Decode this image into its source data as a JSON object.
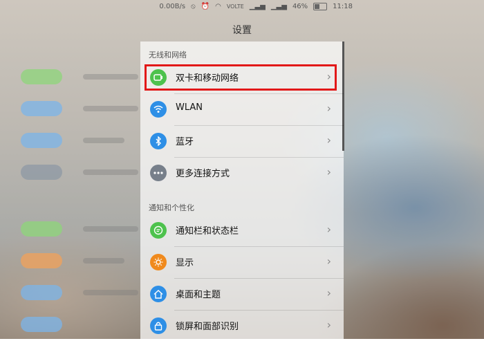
{
  "status_bar": {
    "speed": "0.00B/s",
    "volte": "VOLTE",
    "battery": "46%",
    "time": "11:18"
  },
  "header": {
    "title": "设置"
  },
  "sections": [
    {
      "title": "无线和网络",
      "items": [
        {
          "label": "双卡和移动网络",
          "icon": "dual-sim-icon",
          "color": "#4dc24d",
          "highlighted": true
        },
        {
          "label": "WLAN",
          "icon": "wifi-icon",
          "color": "#2e8fe6"
        },
        {
          "label": "蓝牙",
          "icon": "bluetooth-icon",
          "color": "#2e8fe6"
        },
        {
          "label": "更多连接方式",
          "icon": "more-icon",
          "color": "#777f8a"
        }
      ]
    },
    {
      "title": "通知和个性化",
      "items": [
        {
          "label": "通知栏和状态栏",
          "icon": "notification-icon",
          "color": "#4dc24d"
        },
        {
          "label": "显示",
          "icon": "display-icon",
          "color": "#f08a1d"
        },
        {
          "label": "桌面和主题",
          "icon": "home-icon",
          "color": "#2e8fe6"
        },
        {
          "label": "锁屏和面部识别",
          "icon": "lock-icon",
          "color": "#2e8fe6"
        }
      ]
    }
  ],
  "chevron": "›"
}
